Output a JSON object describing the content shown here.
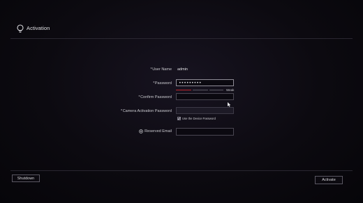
{
  "header": {
    "title": "Activation",
    "icon": "lightbulb-icon"
  },
  "form": {
    "user_name_label": "User Name",
    "user_name_value": "admin",
    "password_label": "Password",
    "password_value": "•••••••••",
    "strength_text": "Weak",
    "strength_level": 0.25,
    "confirm_password_label": "Confirm Password",
    "confirm_password_value": "",
    "camera_password_label": "Camera Activation Password",
    "camera_password_value": "",
    "use_device_password_label": "Use the Device Password",
    "use_device_password_checked": true,
    "reserved_email_label": "Reserved Email",
    "reserved_email_value": "",
    "required_marker": "*"
  },
  "footer": {
    "shutdown_label": "Shutdown",
    "activate_label": "Activate"
  },
  "colors": {
    "strength_weak": "#c0262c",
    "strength_empty": "#5a5862",
    "background": "#09070c"
  }
}
